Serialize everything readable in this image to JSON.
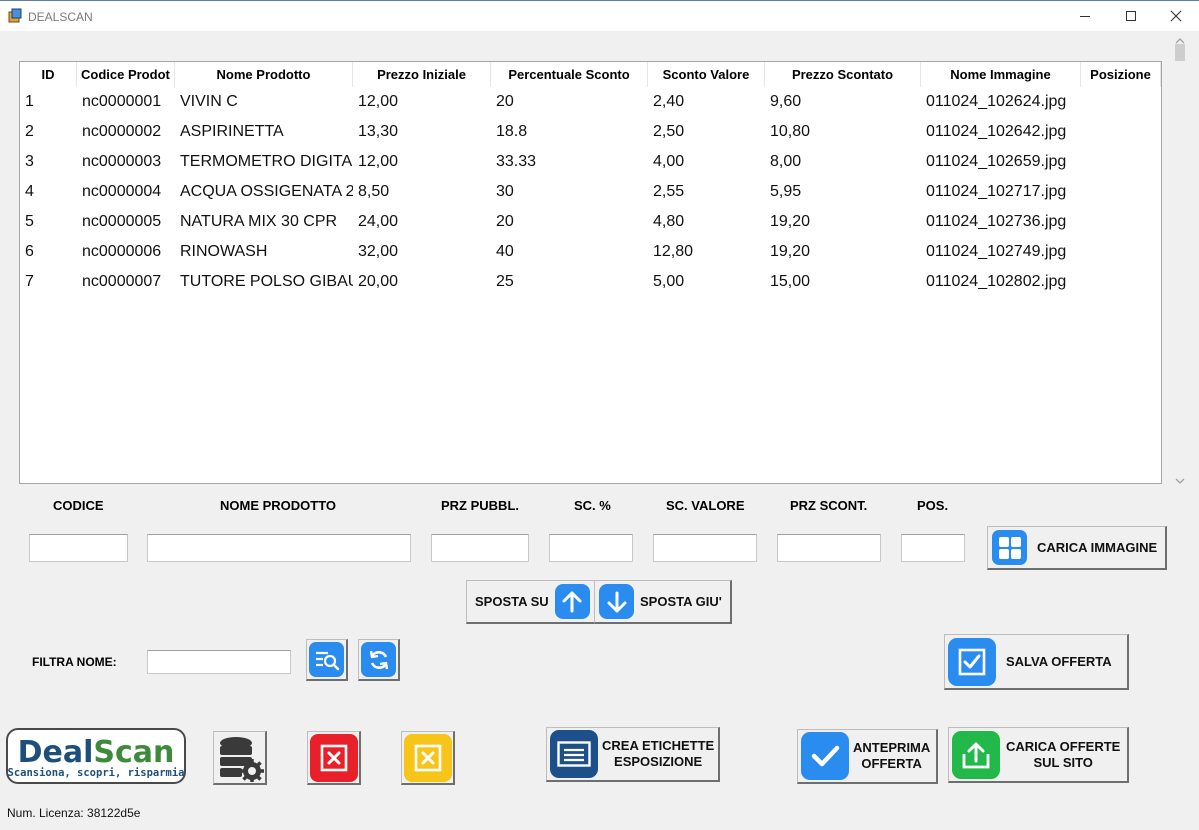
{
  "window": {
    "title": "DEALSCAN"
  },
  "table": {
    "headers": [
      "ID",
      "Codice Prodot",
      "Nome Prodotto",
      "Prezzo Iniziale",
      "Percentuale Sconto",
      "Sconto Valore",
      "Prezzo Scontato",
      "Nome Immagine",
      "Posizione"
    ],
    "rows": [
      [
        "1",
        "nc0000001",
        "VIVIN C",
        "12,00",
        "20",
        "2,40",
        "9,60",
        "011024_102624.jpg",
        ""
      ],
      [
        "2",
        "nc0000002",
        "ASPIRINETTA",
        "13,30",
        "18.8",
        "2,50",
        "10,80",
        "011024_102642.jpg",
        ""
      ],
      [
        "3",
        "nc0000003",
        "TERMOMETRO DIGITAL",
        "12,00",
        "33.33",
        "4,00",
        "8,00",
        "011024_102659.jpg",
        ""
      ],
      [
        "4",
        "nc0000004",
        "ACQUA OSSIGENATA 2",
        "8,50",
        "30",
        "2,55",
        "5,95",
        "011024_102717.jpg",
        ""
      ],
      [
        "5",
        "nc0000005",
        "NATURA MIX 30 CPR",
        "24,00",
        "20",
        "4,80",
        "19,20",
        "011024_102736.jpg",
        ""
      ],
      [
        "6",
        "nc0000006",
        "RINOWASH",
        "32,00",
        "40",
        "12,80",
        "19,20",
        "011024_102749.jpg",
        ""
      ],
      [
        "7",
        "nc0000007",
        "TUTORE POLSO GIBAUD",
        "20,00",
        "25",
        "5,00",
        "15,00",
        "011024_102802.jpg",
        ""
      ]
    ]
  },
  "form": {
    "codice_label": "CODICE",
    "nome_label": "NOME PRODOTTO",
    "prz_pubbl_label": "PRZ PUBBL.",
    "sc_perc_label": "SC. %",
    "sc_valore_label": "SC. VALORE",
    "prz_scont_label": "PRZ SCONT.",
    "pos_label": "POS.",
    "filtra_label": "FILTRA NOME:",
    "codice_value": "",
    "nome_value": "",
    "prz_pubbl_value": "",
    "sc_perc_value": "",
    "sc_valore_value": "",
    "prz_scont_value": "",
    "pos_value": "",
    "filtra_value": ""
  },
  "buttons": {
    "carica_immagine": "CARICA IMMAGINE",
    "sposta_su": "SPOSTA SU",
    "sposta_giu": "SPOSTA GIU'",
    "salva_offerta": "SALVA OFFERTA",
    "crea_etichette_1": "CREA ETICHETTE",
    "crea_etichette_2": "ESPOSIZIONE",
    "anteprima_1": "ANTEPRIMA",
    "anteprima_2": "OFFERTA",
    "carica_offerte_1": "CARICA OFFERTE",
    "carica_offerte_2": "SUL SITO"
  },
  "logo": {
    "name": "DealScan",
    "tagline": "Scansiona, scopri, risparmia"
  },
  "footer": {
    "licence": "Num. Licenza: 38122d5e"
  },
  "colors": {
    "accent_blue": "#2b8cf0",
    "red": "#e8202a",
    "yellow": "#f7c51a",
    "green": "#22b84a",
    "logo_blue": "#1d4f7a",
    "logo_green": "#3c8a3a"
  }
}
